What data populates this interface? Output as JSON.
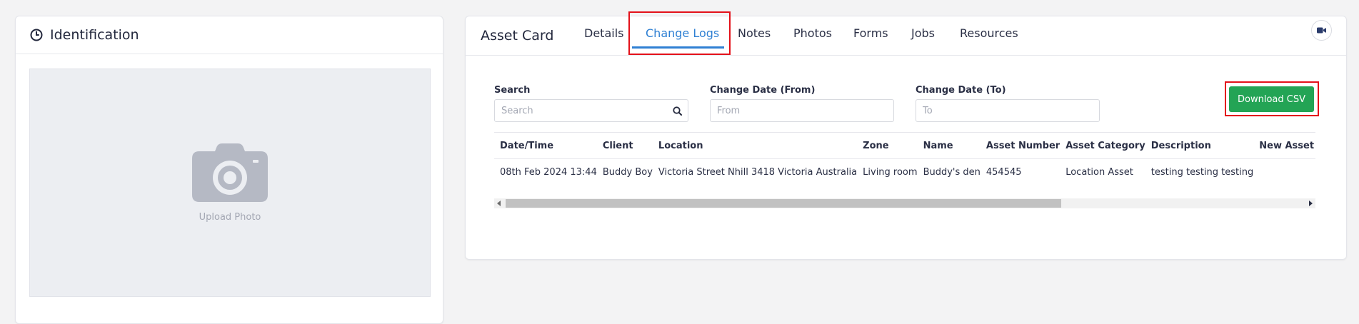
{
  "identification": {
    "title": "Identification",
    "clock_icon": "clock-icon",
    "upload_label": "Upload Photo",
    "camera_icon": "camera-icon"
  },
  "asset_card": {
    "title": "Asset Card",
    "tabs": [
      {
        "label": "Details",
        "active": false
      },
      {
        "label": "Change Logs",
        "active": true
      },
      {
        "label": "Notes",
        "active": false
      },
      {
        "label": "Photos",
        "active": false
      },
      {
        "label": "Forms",
        "active": false
      },
      {
        "label": "Jobs",
        "active": false
      },
      {
        "label": "Resources",
        "active": false
      }
    ],
    "video_icon": "video-camera-icon"
  },
  "filters": {
    "search": {
      "label": "Search",
      "placeholder": "Search",
      "icon": "search-icon"
    },
    "from": {
      "label": "Change Date (From)",
      "placeholder": "From"
    },
    "to": {
      "label": "Change Date (To)",
      "placeholder": "To"
    }
  },
  "download_label": "Download CSV",
  "table": {
    "headers": [
      "Date/Time",
      "Client",
      "Location",
      "Zone",
      "Name",
      "Asset Number",
      "Asset Category",
      "Description",
      "New Asset Fie"
    ],
    "rows": [
      [
        "08th Feb 2024 13:44",
        "Buddy Boy",
        "Victoria Street Nhill 3418 Victoria Australia",
        "Living room",
        "Buddy's den",
        "454545",
        "Location Asset",
        "testing testing testing",
        ""
      ]
    ]
  },
  "colors": {
    "accent_blue": "#2f80d3",
    "download_green": "#23a455",
    "highlight_red": "#e3111a"
  }
}
